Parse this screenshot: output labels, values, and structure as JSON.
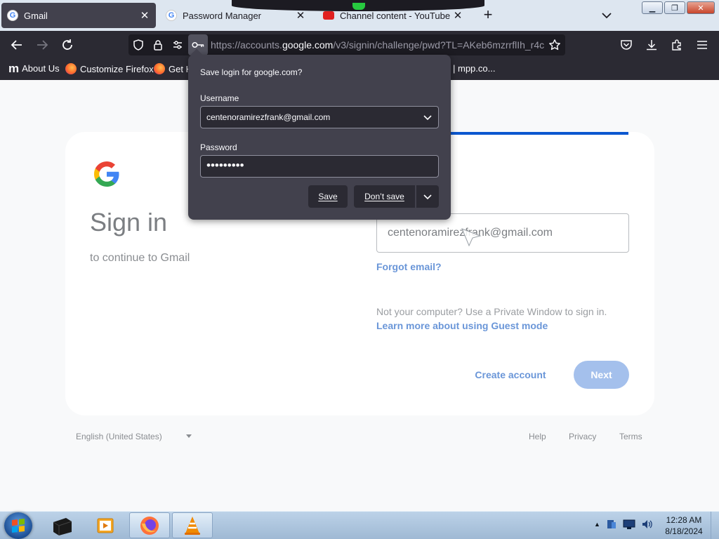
{
  "browser": {
    "tabs": [
      {
        "title": "Gmail",
        "active": true
      },
      {
        "title": "Password Manager",
        "active": false
      },
      {
        "title": "Channel content - YouTube Studio",
        "active": false
      }
    ],
    "url": {
      "prefix": "https://accounts.",
      "domain": "google.com",
      "suffix": "/v3/signin/challenge/pwd?TL=AKeb6mzrrflIh_r4c"
    },
    "bookmarks": [
      {
        "label": "About Us",
        "icon": "m-logo-icon"
      },
      {
        "label": "Customize Firefox",
        "icon": "firefox-icon"
      },
      {
        "label": "Get H",
        "icon": "firefox-icon"
      },
      {
        "label": "| mpp.co...",
        "icon": ""
      }
    ]
  },
  "popup": {
    "title": "Save login for google.com?",
    "username_label": "Username",
    "username_value": "centenoramirezfrank@gmail.com",
    "password_label": "Password",
    "password_value": "•••••••••",
    "save_label": "Save",
    "dont_save_label": "Don’t save"
  },
  "page": {
    "title": "Sign in",
    "subtitle": "to continue to Gmail",
    "email_value": "centenoramirezfrank@gmail.com",
    "forgot_email": "Forgot email?",
    "not_your_computer": "Not your computer? Use a Private Window to sign in.",
    "guest_mode_link": "Learn more about using Guest mode",
    "create_account": "Create account",
    "next": "Next",
    "language": "English (United States)",
    "footer_links": [
      "Help",
      "Privacy",
      "Terms"
    ]
  },
  "taskbar": {
    "time": "12:28 AM",
    "date": "8/18/2024"
  },
  "colors": {
    "accent_blue": "#0b57d0",
    "link_blue": "#6a96d8",
    "popup_bg": "#42414d",
    "toolbar_bg": "#2b2a33"
  }
}
